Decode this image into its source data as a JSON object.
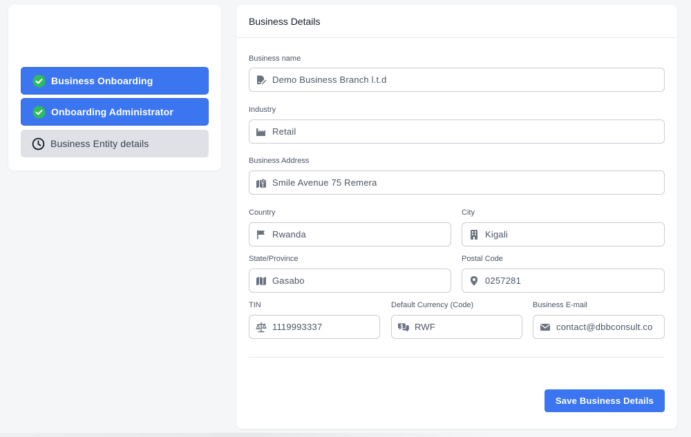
{
  "sidebar": {
    "steps": [
      {
        "label": "Business Onboarding",
        "status": "done",
        "icon": "check-circle-icon"
      },
      {
        "label": "Onboarding Administrator",
        "status": "done",
        "icon": "check-circle-icon"
      },
      {
        "label": "Business Entity details",
        "status": "pending",
        "icon": "clock-icon"
      }
    ]
  },
  "form": {
    "title": "Business Details",
    "fields": {
      "business_name": {
        "label": "Business name",
        "value": "Demo Business Branch l.t.d",
        "icon": "signature-icon"
      },
      "industry": {
        "label": "Industry",
        "value": "Retail",
        "icon": "industry-icon"
      },
      "business_address": {
        "label": "Business Address",
        "value": "Smile Avenue 75 Remera",
        "icon": "map-location-icon"
      },
      "country": {
        "label": "Country",
        "value": "Rwanda",
        "icon": "flag-icon"
      },
      "city": {
        "label": "City",
        "value": "Kigali",
        "icon": "building-icon"
      },
      "state": {
        "label": "State/Province",
        "value": "Gasabo",
        "icon": "map-icon"
      },
      "postal_code": {
        "label": "Postal Code",
        "value": "0257281",
        "icon": "location-pin-icon"
      },
      "tin": {
        "label": "TIN",
        "value": "1119993337",
        "icon": "scale-icon"
      },
      "currency": {
        "label": "Default Currency (Code)",
        "value": "RWF",
        "icon": "money-comments-icon"
      },
      "email": {
        "label": "Business E-mail",
        "value": "contact@dbbconsult.co",
        "icon": "envelope-icon"
      }
    },
    "save_label": "Save Business Details"
  },
  "colors": {
    "accent": "#3b76f0",
    "success": "#2dbd5a",
    "pending_bg": "#dfe1e6",
    "icon_gray": "#6b7280"
  }
}
